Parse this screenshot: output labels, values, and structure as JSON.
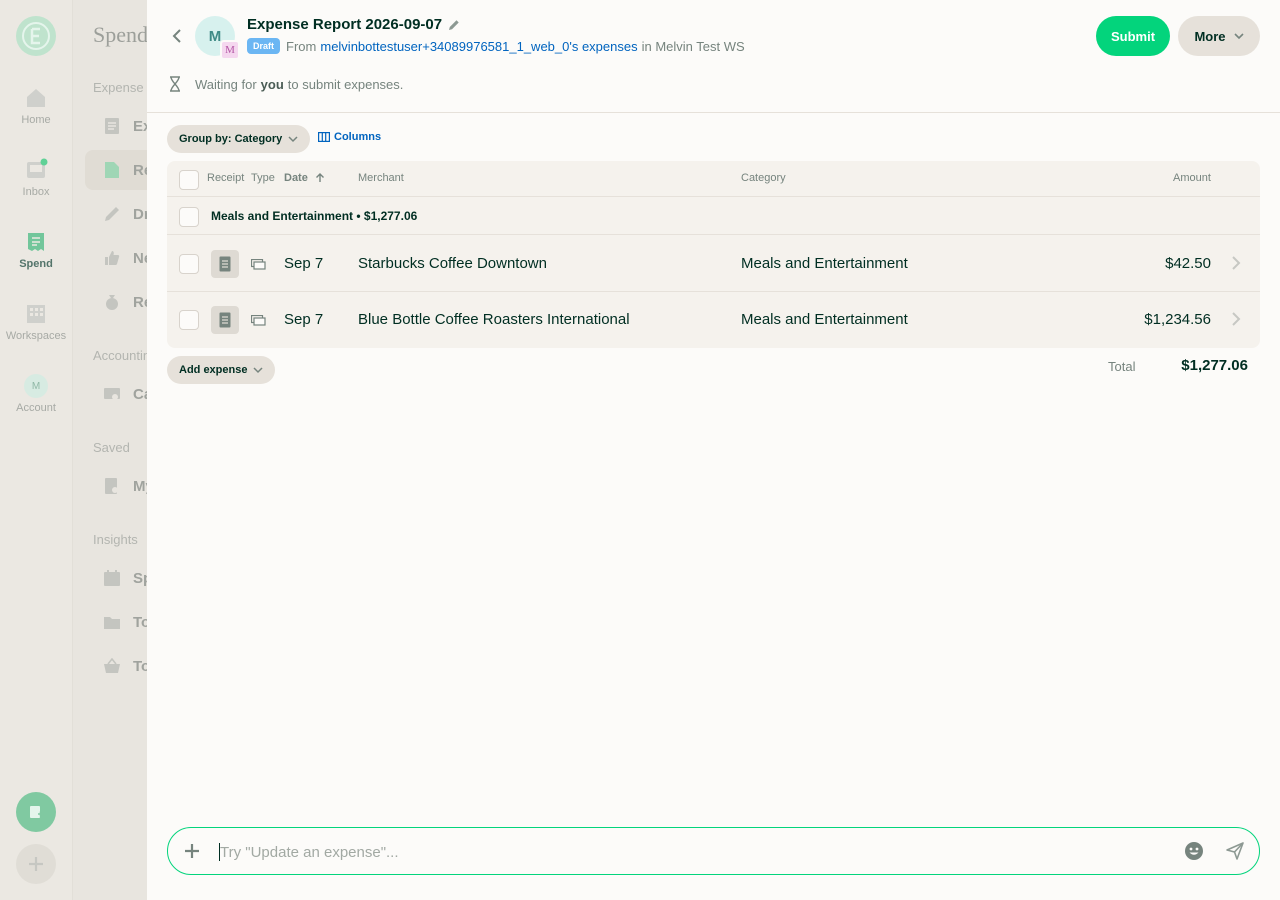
{
  "nav": {
    "items": [
      {
        "label": "Home",
        "icon": "home-icon"
      },
      {
        "label": "Inbox",
        "icon": "inbox-icon"
      },
      {
        "label": "Spend",
        "icon": "receipt-icon"
      },
      {
        "label": "Workspaces",
        "icon": "building-icon"
      },
      {
        "label": "Account",
        "icon": "avatar",
        "initial": "M"
      }
    ]
  },
  "sidebar": {
    "title": "Spend",
    "sections": [
      "Expense r",
      "Accountin",
      "Saved",
      "Insights"
    ],
    "items": [
      {
        "label": "Ex",
        "icon": "document-icon"
      },
      {
        "label": "Re",
        "icon": "report-icon"
      },
      {
        "label": "Dr",
        "icon": "pencil-icon"
      },
      {
        "label": "Ne",
        "icon": "thumbs-up-icon"
      },
      {
        "label": "Re",
        "icon": "money-bag-icon"
      },
      {
        "label": "Ca",
        "icon": "card-icon"
      },
      {
        "label": "My",
        "icon": "saved-search-icon"
      },
      {
        "label": "Sp",
        "icon": "calendar-icon"
      },
      {
        "label": "To",
        "icon": "folder-icon"
      },
      {
        "label": "To",
        "icon": "basket-icon"
      }
    ]
  },
  "header": {
    "avatar_initial": "M",
    "workspace_initial": "M",
    "title": "Expense Report 2026-09-07",
    "status_badge": "Draft",
    "from_label": "From",
    "from_link": "melvinbottestuser+34089976581_1_web_0's expenses",
    "in_label": "in Melvin Test WS",
    "submit_label": "Submit",
    "more_label": "More",
    "wait_prefix": "Waiting for",
    "wait_bold": "you",
    "wait_suffix": "to submit expenses."
  },
  "toolbar": {
    "group_by_label": "Group by: Category",
    "columns_label": "Columns"
  },
  "table": {
    "columns": [
      "Receipt",
      "Type",
      "Date",
      "Merchant",
      "Category",
      "Amount"
    ],
    "group": "Meals and Entertainment • $1,277.06",
    "rows": [
      {
        "date": "Sep 7",
        "merchant": "Starbucks Coffee Downtown",
        "category": "Meals and Entertainment",
        "amount": "$42.50"
      },
      {
        "date": "Sep 7",
        "merchant": "Blue Bottle Coffee Roasters International",
        "category": "Meals and Entertainment",
        "amount": "$1,234.56"
      }
    ]
  },
  "footer": {
    "add_expense_label": "Add expense",
    "total_label": "Total",
    "total_value": "$1,277.06"
  },
  "composer": {
    "placeholder": "Try \"Update an expense\"...",
    "value": ""
  },
  "colors": {
    "accent": "#03d47c",
    "link": "#0164bf",
    "badge": "#6bb6f3",
    "text": "#002e22"
  }
}
